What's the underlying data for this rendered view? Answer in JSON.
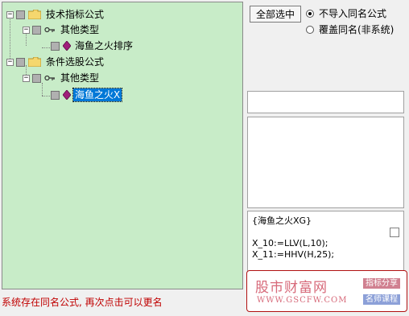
{
  "tree": {
    "nodes": [
      {
        "label": "技术指标公式",
        "kind": "folder",
        "expander": "−",
        "level": 0
      },
      {
        "label": "其他类型",
        "kind": "key",
        "expander": "−",
        "level": 1
      },
      {
        "label": "海鱼之火排序",
        "kind": "formula",
        "level": 2
      },
      {
        "label": "条件选股公式",
        "kind": "folder",
        "expander": "−",
        "level": 0
      },
      {
        "label": "其他类型",
        "kind": "key",
        "expander": "−",
        "level": 1
      },
      {
        "label": "海鱼之火X",
        "kind": "formula",
        "level": 2,
        "selected": true
      }
    ]
  },
  "status_message": "系统存在同名公式, 再次点击可以更名",
  "select_all_label": "全部选中",
  "options": [
    {
      "label": "不导入同名公式",
      "checked": true
    },
    {
      "label": "覆盖同名(非系统)",
      "checked": false
    }
  ],
  "code_lines": [
    "{海鱼之火XG}",
    "",
    "X_10:=LLV(L,10);",
    "X_11:=HHV(H,25);"
  ],
  "watermark": {
    "title": "股市财富网",
    "url": "WWW.GSCFW.COM",
    "tag1": "指标分享",
    "tag2": "名师课程"
  },
  "colors": {
    "tree_background": "#c8ecc8",
    "selection": "#0078d7",
    "status_text": "#c00000"
  }
}
